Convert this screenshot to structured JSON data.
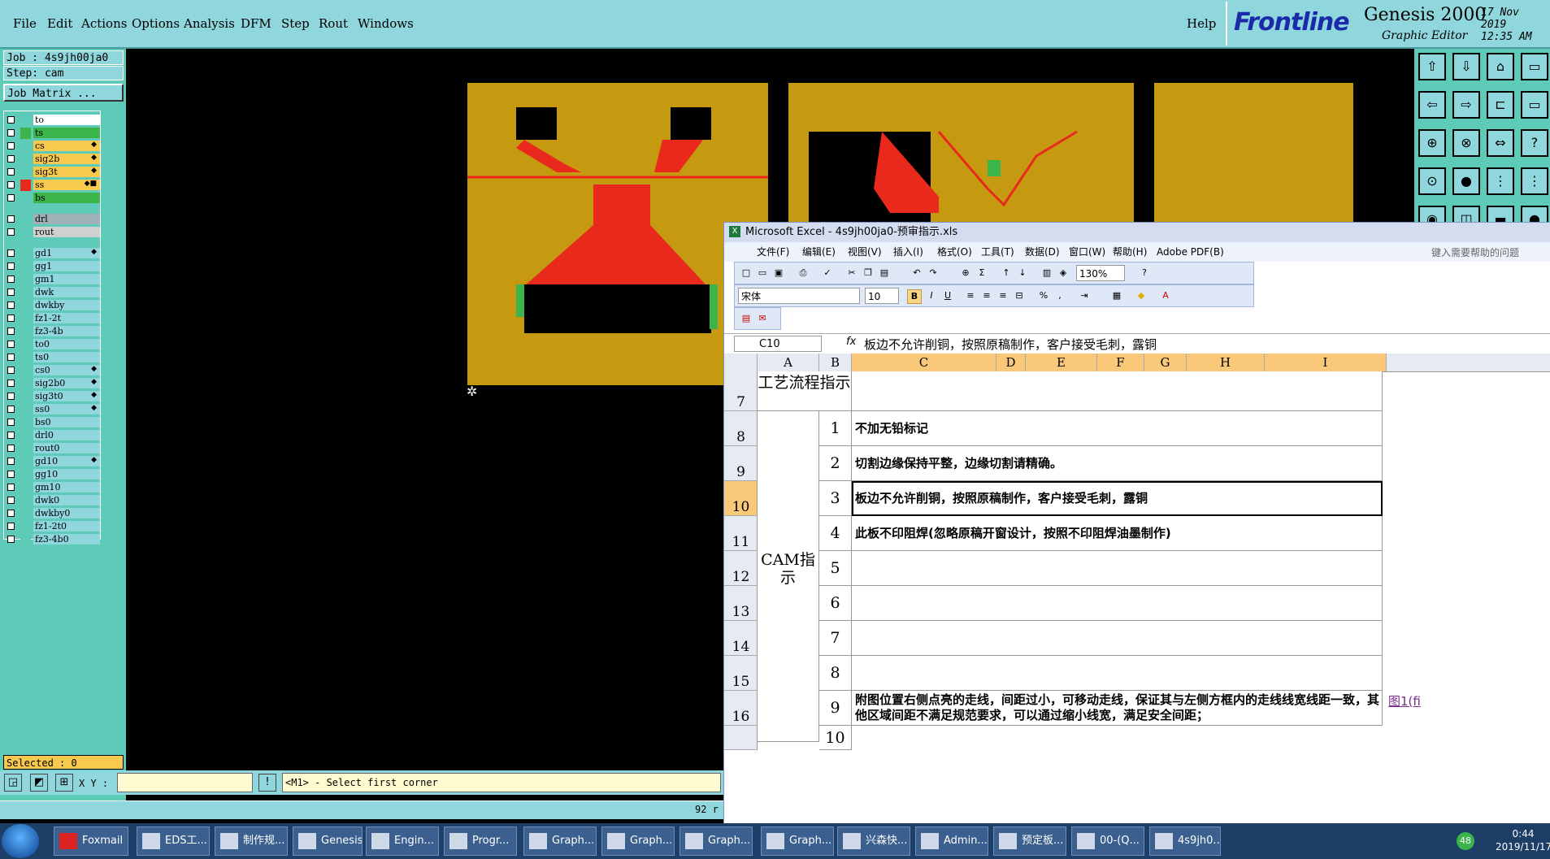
{
  "menubar": {
    "items": [
      "File",
      "Edit",
      "Actions",
      "Options",
      "Analysis",
      "DFM",
      "Step",
      "Rout",
      "Windows"
    ],
    "help": "Help",
    "brand": "Frontline",
    "product": "Genesis 2000",
    "product_sub": "Graphic Editor",
    "date": "17 Nov 2019",
    "time": "12:35 AM"
  },
  "job": {
    "job_label": "Job : 4s9jh00ja0",
    "step_label": "Step: cam",
    "matrix_button": "Job Matrix ..."
  },
  "layers": [
    {
      "name": "to",
      "color": "#ffffff",
      "mark": ""
    },
    {
      "name": "ts",
      "color": "#3bb54a",
      "mark": ""
    },
    {
      "name": "cs",
      "color": "#f7c94e",
      "mark": "◆"
    },
    {
      "name": "sig2b",
      "color": "#f7c94e",
      "mark": "◆"
    },
    {
      "name": "sig3t",
      "color": "#f7c94e",
      "mark": "◆"
    },
    {
      "name": "ss",
      "color": "#f7c94e",
      "mark": "◆■"
    },
    {
      "name": "bs",
      "color": "#3bb54a",
      "mark": ""
    },
    {
      "name": "drl",
      "color": "#9fb0b6",
      "mark": ""
    },
    {
      "name": "rout",
      "color": "#d0d0d0",
      "mark": ""
    },
    {
      "name": "gd1",
      "color": "#8fd6dd",
      "mark": "◆"
    },
    {
      "name": "gg1",
      "color": "#8fd6dd",
      "mark": ""
    },
    {
      "name": "gm1",
      "color": "#8fd6dd",
      "mark": ""
    },
    {
      "name": "dwk",
      "color": "#8fd6dd",
      "mark": ""
    },
    {
      "name": "dwkby",
      "color": "#8fd6dd",
      "mark": ""
    },
    {
      "name": "fz1-2t",
      "color": "#8fd6dd",
      "mark": ""
    },
    {
      "name": "fz3-4b",
      "color": "#8fd6dd",
      "mark": ""
    },
    {
      "name": "to0",
      "color": "#8fd6dd",
      "mark": ""
    },
    {
      "name": "ts0",
      "color": "#8fd6dd",
      "mark": ""
    },
    {
      "name": "cs0",
      "color": "#8fd6dd",
      "mark": "◆"
    },
    {
      "name": "sig2b0",
      "color": "#8fd6dd",
      "mark": "◆"
    },
    {
      "name": "sig3t0",
      "color": "#8fd6dd",
      "mark": "◆"
    },
    {
      "name": "ss0",
      "color": "#8fd6dd",
      "mark": "◆"
    },
    {
      "name": "bs0",
      "color": "#8fd6dd",
      "mark": ""
    },
    {
      "name": "drl0",
      "color": "#8fd6dd",
      "mark": ""
    },
    {
      "name": "rout0",
      "color": "#8fd6dd",
      "mark": ""
    },
    {
      "name": "gd10",
      "color": "#8fd6dd",
      "mark": "◆"
    },
    {
      "name": "gg10",
      "color": "#8fd6dd",
      "mark": ""
    },
    {
      "name": "gm10",
      "color": "#8fd6dd",
      "mark": ""
    },
    {
      "name": "dwk0",
      "color": "#8fd6dd",
      "mark": ""
    },
    {
      "name": "dwkby0",
      "color": "#8fd6dd",
      "mark": ""
    },
    {
      "name": "fz1-2t0",
      "color": "#8fd6dd",
      "mark": ""
    },
    {
      "name": "fz3-4b0",
      "color": "#8fd6dd",
      "mark": ""
    }
  ],
  "status": {
    "selected": "Selected : 0",
    "xy_label": "X Y :",
    "prompt": "<M1> - Select first corner",
    "bottom_number": "92 r"
  },
  "excel": {
    "title": "Microsoft Excel - 4s9jh00ja0-预审指示.xls",
    "menus": [
      "文件(F)",
      "编辑(E)",
      "视图(V)",
      "插入(I)",
      "格式(O)",
      "工具(T)",
      "数据(D)",
      "窗口(W)",
      "帮助(H)",
      "Adobe PDF(B)"
    ],
    "help_search": "键入需要帮助的问题",
    "zoom": "130%",
    "font_name": "宋体",
    "font_size": "10",
    "name_box": "C10",
    "fx": "fx",
    "formula": "板边不允许削铜，按照原稿制作，客户接受毛刺，露铜",
    "columns": [
      "A",
      "B",
      "C",
      "D",
      "E",
      "F",
      "G",
      "H",
      "I"
    ],
    "header_row": {
      "row": "7",
      "label": "工艺流程指示"
    },
    "cam_label": "CAM指示",
    "rows": [
      {
        "row": "8",
        "num": "1",
        "text": "不加无铅标记"
      },
      {
        "row": "9",
        "num": "2",
        "text": "切割边缘保持平整，边缘切割请精确。"
      },
      {
        "row": "10",
        "num": "3",
        "text": "板边不允许削铜，按照原稿制作，客户接受毛刺，露铜"
      },
      {
        "row": "11",
        "num": "4",
        "text": "此板不印阻焊(忽略原稿开窗设计，按照不印阻焊油墨制作)"
      },
      {
        "row": "12",
        "num": "5",
        "text": ""
      },
      {
        "row": "13",
        "num": "6",
        "text": ""
      },
      {
        "row": "14",
        "num": "7",
        "text": ""
      },
      {
        "row": "15",
        "num": "8",
        "text": ""
      },
      {
        "row": "16",
        "num": "9",
        "text": "附图位置右侧点亮的走线，间距过小，可移动走线，保证其与左侧方框内的走线线宽线距一致，其他区域间距不满足规范要求，可以通过缩小线宽，满足安全间距；"
      }
    ],
    "next_row_num": "10",
    "link_text": "图1(fi"
  },
  "taskbar": {
    "items": [
      "Foxmail",
      "EDS工...",
      "制作规...",
      "Genesis",
      "Engin...",
      "Progr...",
      "Graph...",
      "Graph...",
      "Graph...",
      "Graph...",
      "兴森快...",
      "Admin...",
      "预定板...",
      "00-(Q...",
      "4s9jh0..."
    ],
    "tray_badge": "48",
    "clock_time": "0:44",
    "clock_date": "2019/11/17"
  }
}
